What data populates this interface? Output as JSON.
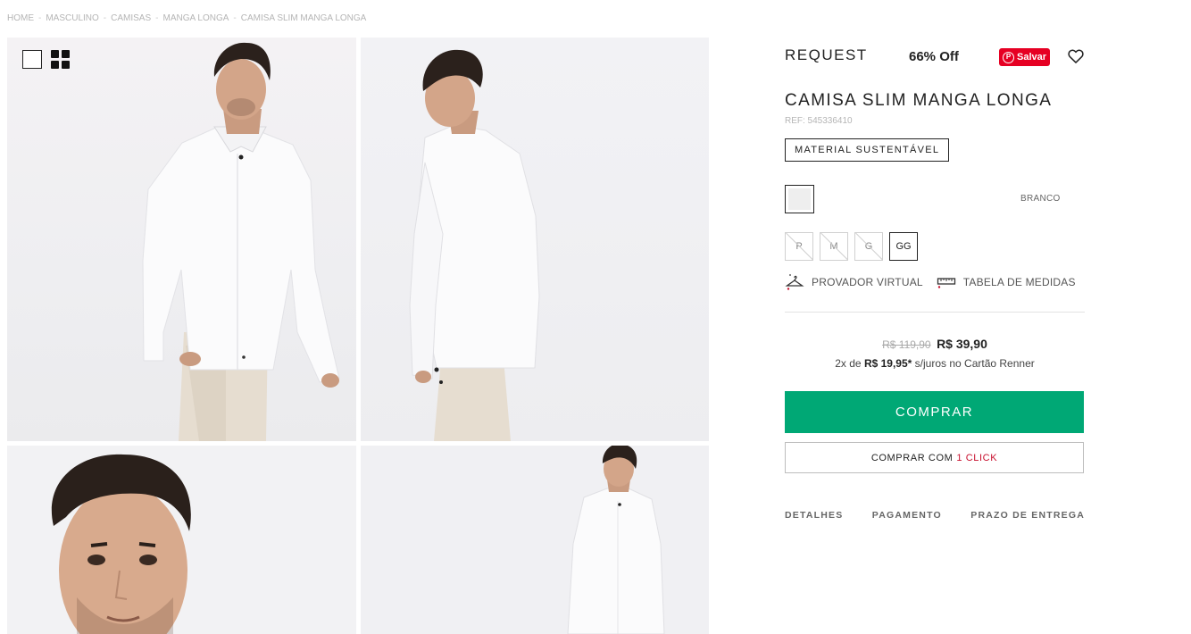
{
  "breadcrumb": [
    "HOME",
    "MASCULINO",
    "CAMISAS",
    "MANGA LONGA",
    "CAMISA SLIM MANGA LONGA"
  ],
  "breadcrumb_separator": "-",
  "gallery": {
    "view_single_icon": "single-view-icon",
    "view_grid_icon": "grid-view-icon"
  },
  "product": {
    "brand": "REQUEST",
    "discount": "66% Off",
    "pinterest_label": "Salvar",
    "pinterest_logo": "P",
    "title": "CAMISA SLIM MANGA LONGA",
    "ref": "REF: 545336410",
    "badge": "MATERIAL SUSTENTÁVEL",
    "color_name": "BRANCO",
    "swatch_color": "#eeeeee",
    "sizes": [
      {
        "label": "P",
        "available": false,
        "selected": false
      },
      {
        "label": "M",
        "available": false,
        "selected": false
      },
      {
        "label": "G",
        "available": false,
        "selected": false
      },
      {
        "label": "GG",
        "available": true,
        "selected": true
      }
    ],
    "tools": {
      "fitting_room": "PROVADOR VIRTUAL",
      "size_chart": "TABELA DE MEDIDAS"
    },
    "price_old": "R$ 119,90",
    "price_new": "R$ 39,90",
    "installment_prefix": "2x de",
    "installment_value": "R$ 19,95*",
    "installment_suffix": "s/juros no Cartão Renner",
    "buy_label": "COMPRAR",
    "oneclick_prefix": "COMPRAR COM",
    "oneclick_accent": "1 CLICK",
    "info_tabs": [
      "DETALHES",
      "PAGAMENTO",
      "PRAZO DE ENTREGA"
    ]
  },
  "colors": {
    "buy_button": "#00a875",
    "pinterest": "#e60023",
    "oneclick_accent": "#c8102e"
  }
}
